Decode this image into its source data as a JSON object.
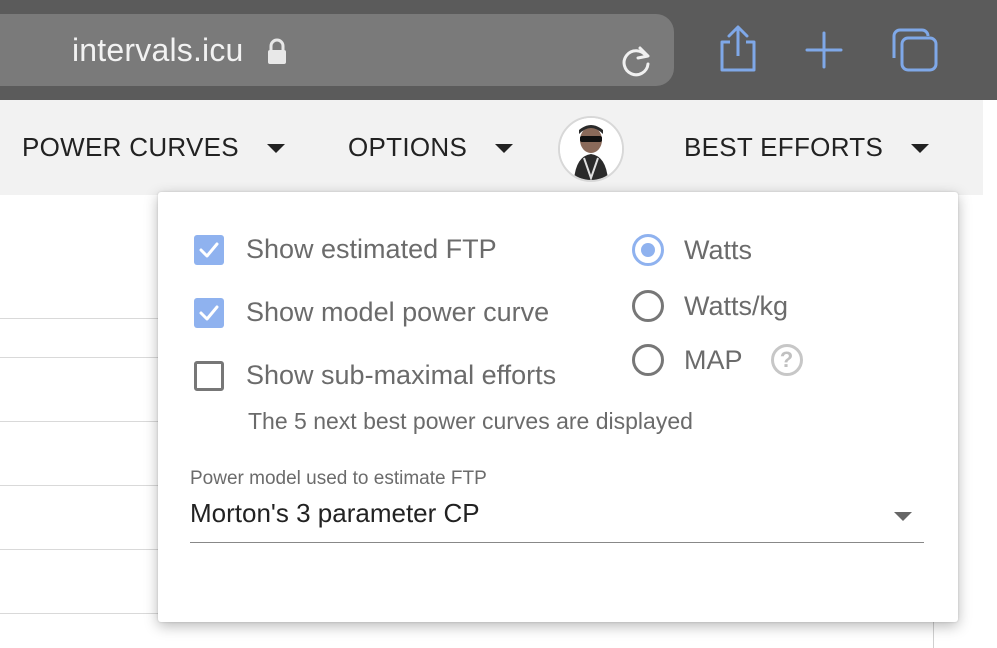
{
  "browser": {
    "url": "intervals.icu",
    "icons": [
      "lock-icon",
      "reload-icon",
      "share-icon",
      "plus-icon",
      "tabs-icon"
    ]
  },
  "nav": {
    "power_curves": "POWER CURVES",
    "options": "OPTIONS",
    "best_efforts": "BEST EFFORTS"
  },
  "options_panel": {
    "show_estimated_ftp": {
      "label": "Show estimated FTP",
      "checked": true
    },
    "show_model_power_curve": {
      "label": "Show model power curve",
      "checked": true
    },
    "show_sub_maximal_efforts": {
      "label": "Show sub-maximal efforts",
      "checked": false
    },
    "sub_maximal_hint": "The 5 next best power curves are displayed",
    "units": {
      "watts": {
        "label": "Watts",
        "selected": true
      },
      "watts_kg": {
        "label": "Watts/kg",
        "selected": false
      },
      "map": {
        "label": "MAP",
        "selected": false
      }
    },
    "power_model": {
      "label": "Power model used to estimate FTP",
      "value": "Morton's 3 parameter CP"
    }
  },
  "colors": {
    "accent": "#8fb2ef",
    "browser_bar": "#5b5b5b",
    "nav_bg": "#f2f2f2"
  }
}
